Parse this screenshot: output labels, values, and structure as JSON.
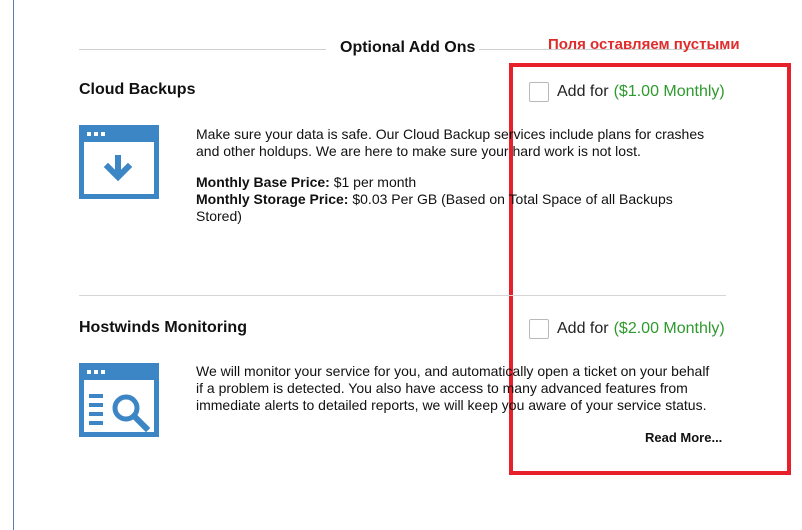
{
  "section": {
    "title": "Optional Add Ons"
  },
  "annotation": {
    "text": "Поля оставляем пустыми",
    "color": "#e8202a"
  },
  "addons": [
    {
      "title": "Cloud Backups",
      "icon": "cloud-backup-download-icon",
      "description": "Make sure your data is safe. Our Cloud Backup services include plans for crashes and other holdups. We are here to make sure your hard work is not lost.",
      "details": [
        {
          "label": "Monthly Base Price:",
          "value": "$1 per month"
        },
        {
          "label": "Monthly Storage Price:",
          "value": "$0.03 Per GB (Based on Total Space of all Backups Stored)"
        }
      ],
      "option": {
        "label": "Add for",
        "price": "($1.00 Monthly)",
        "checked": false
      }
    },
    {
      "title": "Hostwinds Monitoring",
      "icon": "monitoring-search-icon",
      "description": "We will monitor your service for you, and automatically open a ticket on your behalf if a problem is detected. You also have access to many advanced features from immediate alerts to detailed reports, we will keep you aware of your service status.",
      "option": {
        "label": "Add for",
        "price": "($2.00 Monthly)",
        "checked": false
      },
      "read_more": "Read More..."
    }
  ],
  "colors": {
    "accent_blue": "#3d86c6",
    "price_green": "#2e9a2e"
  }
}
